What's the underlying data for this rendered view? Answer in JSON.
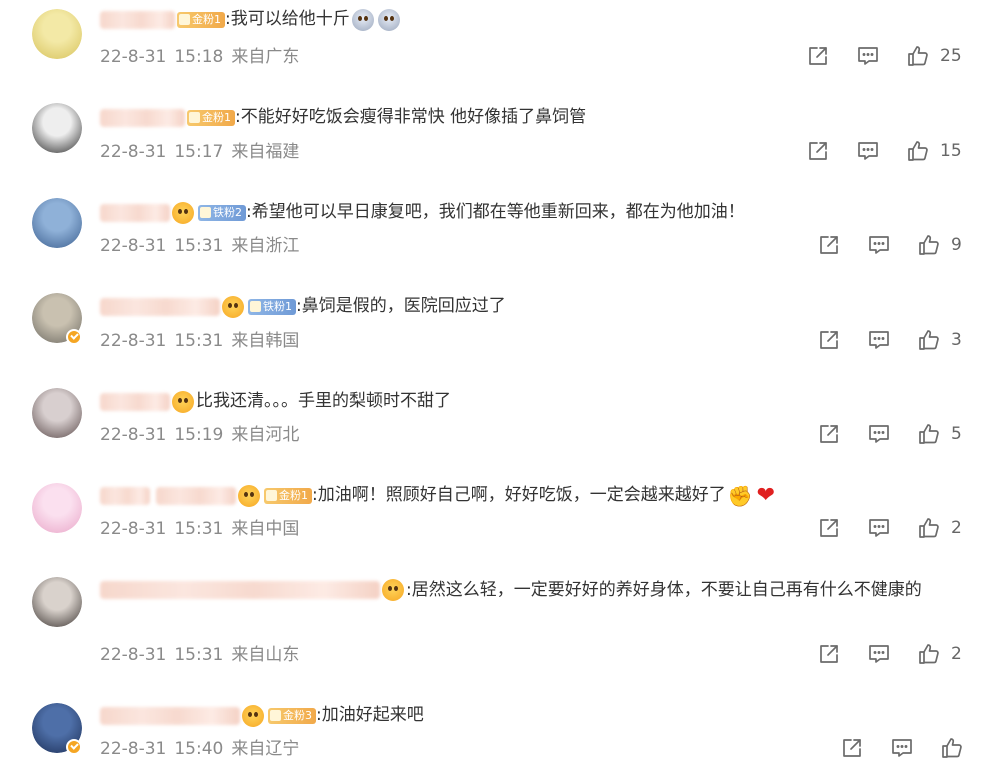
{
  "comments": [
    {
      "badge": {
        "type": "gold",
        "label": "金粉1"
      },
      "prefix_emoji": [],
      "text": ":我可以给他十斤",
      "suffix_emoji": [
        "ghost",
        "ghost"
      ],
      "date": "22-8-31",
      "time": "15:18",
      "location": "来自广东",
      "likes": "25",
      "avatar_colors": [
        "#f3e9a6",
        "#d7c25b"
      ],
      "verified": false
    },
    {
      "badge": {
        "type": "gold",
        "label": "金粉1"
      },
      "prefix_emoji": [],
      "text": ":不能好好吃饭会瘦得非常快 他好像插了鼻饲管",
      "suffix_emoji": [],
      "date": "22-8-31",
      "time": "15:17",
      "location": "来自福建",
      "likes": "15",
      "avatar_colors": [
        "#eeeeee",
        "#2b2b2b"
      ],
      "verified": false
    },
    {
      "badge": {
        "type": "iron",
        "label": "铁粉2"
      },
      "prefix_emoji": [
        "face"
      ],
      "text": ":希望他可以早日康复吧，我们都在等他重新回来，都在为他加油！",
      "suffix_emoji": [],
      "date": "22-8-31",
      "time": "15:31",
      "location": "来自浙江",
      "likes": "9",
      "avatar_colors": [
        "#8fb1d8",
        "#3c5f8f"
      ],
      "verified": false
    },
    {
      "badge": {
        "type": "iron",
        "label": "铁粉1"
      },
      "prefix_emoji": [
        "face"
      ],
      "text": ":鼻饲是假的，医院回应过了",
      "suffix_emoji": [],
      "date": "22-8-31",
      "time": "15:31",
      "location": "来自韩国",
      "likes": "3",
      "avatar_colors": [
        "#c9c1b0",
        "#6d6a62"
      ],
      "verified": true
    },
    {
      "badge": null,
      "prefix_emoji": [
        "face"
      ],
      "text": "比我还清。。。手里的梨顿时不甜了",
      "suffix_emoji": [],
      "date": "22-8-31",
      "time": "15:19",
      "location": "来自河北",
      "likes": "5",
      "avatar_colors": [
        "#d8cfcf",
        "#5a4a4a"
      ],
      "verified": false
    },
    {
      "badge": {
        "type": "gold",
        "label": "金粉1"
      },
      "prefix_emoji": [
        "face"
      ],
      "text": ":加油啊！照顾好自己啊，好好吃饭，一定会越来越好了",
      "suffix_emoji": [
        "muscle",
        "heart"
      ],
      "date": "22-8-31",
      "time": "15:31",
      "location": "来自中国",
      "likes": "2",
      "avatar_colors": [
        "#fbe0ef",
        "#e9a6c8"
      ],
      "verified": false
    },
    {
      "badge": null,
      "prefix_emoji": [
        "face"
      ],
      "text": ":居然这么轻，一定要好好的养好身体，不要让自己再有什么不健康的",
      "suffix_emoji": [],
      "date": "22-8-31",
      "time": "15:31",
      "location": "来自山东",
      "likes": "2",
      "avatar_colors": [
        "#d9d2cc",
        "#3a3330"
      ],
      "verified": false
    },
    {
      "badge": {
        "type": "gold",
        "label": "金粉3"
      },
      "prefix_emoji": [
        "face"
      ],
      "text": ":加油好起来吧",
      "suffix_emoji": [],
      "date": "22-8-31",
      "time": "15:40",
      "location": "来自辽宁",
      "likes": "",
      "avatar_colors": [
        "#4e6fa8",
        "#1c2f57"
      ],
      "verified": true
    }
  ],
  "icons": {
    "share": "share-icon",
    "comment": "comment-icon",
    "like": "like-icon"
  },
  "colors": {
    "meta": "#8a8a8a",
    "icon": "#6b6b6b",
    "gold_badge": "#f1a94a",
    "iron_badge": "#6f9ad6"
  }
}
